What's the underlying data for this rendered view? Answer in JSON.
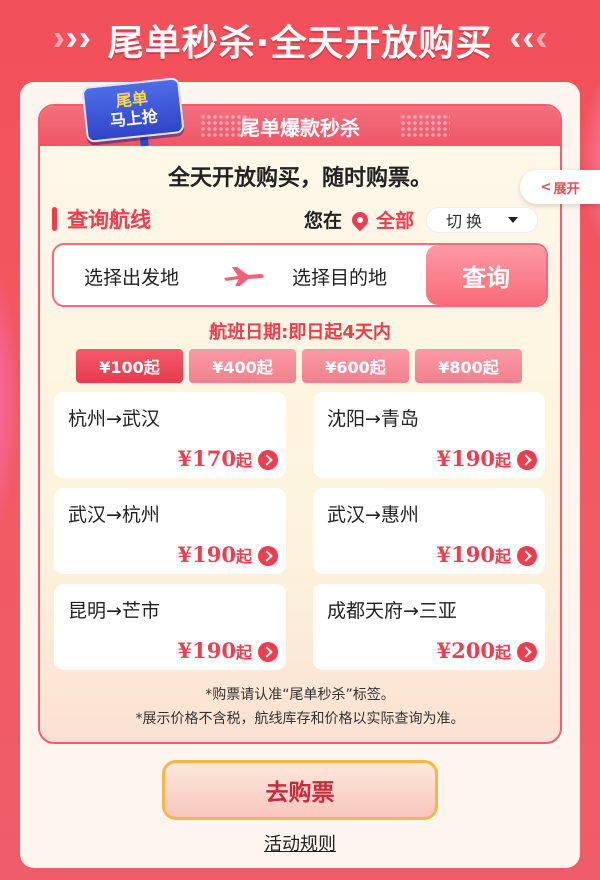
{
  "banner": {
    "title": "尾单秒杀·全天开放购买"
  },
  "panel": {
    "title": "尾单爆款秒杀"
  },
  "sticker": {
    "line1": "尾单",
    "line2": "马上抢"
  },
  "expand": {
    "label": "展开"
  },
  "slogan": "全天开放购买，随时购票。",
  "query": {
    "title": "查询航线",
    "you_are_at": "您在",
    "city": "全部",
    "switch_label": "切换",
    "from_placeholder": "选择出发地",
    "to_placeholder": "选择目的地",
    "search_label": "查询"
  },
  "date_note": "航班日期:即日起4天内",
  "price_tabs": [
    "¥100起",
    "¥400起",
    "¥600起",
    "¥800起"
  ],
  "active_price_tab": 0,
  "routes": [
    {
      "name": "杭州→武汉",
      "price": "¥170",
      "suffix": "起"
    },
    {
      "name": "沈阳→青岛",
      "price": "¥190",
      "suffix": "起"
    },
    {
      "name": "武汉→杭州",
      "price": "¥190",
      "suffix": "起"
    },
    {
      "name": "武汉→惠州",
      "price": "¥190",
      "suffix": "起"
    },
    {
      "name": "昆明→芒市",
      "price": "¥190",
      "suffix": "起"
    },
    {
      "name": "成都天府→三亚",
      "price": "¥200",
      "suffix": "起"
    }
  ],
  "notes": [
    "*购票请认准“尾单秒杀”标签。",
    "*展示价格不含税，航线库存和价格以实际查询为准。"
  ],
  "buy_label": "去购票",
  "rules_label": "活动规则",
  "colors": {
    "brand_red": "#ef3d4f",
    "bg_red": "#f2505a",
    "gold_border": "#f7b64a"
  }
}
